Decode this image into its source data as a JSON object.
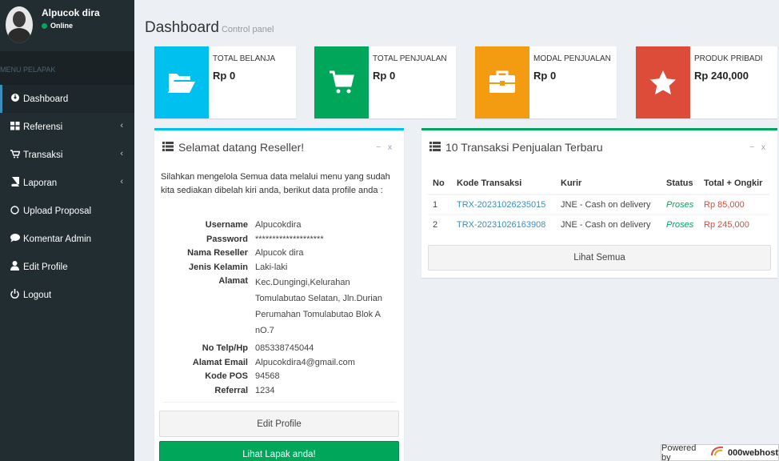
{
  "sidebar": {
    "user_name": "Alpucok dira",
    "user_status": "Online",
    "menu_header": "MENU PELAPAK",
    "items": [
      {
        "label": "Dashboard",
        "icon": "dashboard-icon",
        "has_arrow": false
      },
      {
        "label": "Referensi",
        "icon": "grid-icon",
        "has_arrow": true
      },
      {
        "label": "Transaksi",
        "icon": "cart-icon",
        "has_arrow": true
      },
      {
        "label": "Laporan",
        "icon": "book-icon",
        "has_arrow": true
      },
      {
        "label": "Upload Proposal",
        "icon": "circle-icon",
        "has_arrow": false
      },
      {
        "label": "Komentar Admin",
        "icon": "comment-icon",
        "has_arrow": false
      },
      {
        "label": "Edit Profile",
        "icon": "user-icon",
        "has_arrow": false
      },
      {
        "label": "Logout",
        "icon": "power-icon",
        "has_arrow": false
      }
    ],
    "arrow": "‹"
  },
  "header": {
    "title": "Dashboard",
    "subtitle": "Control panel"
  },
  "info_boxes": [
    {
      "label": "TOTAL BELANJA",
      "value": "Rp 0",
      "icon": "folder-open-icon",
      "color": "#00c0ef"
    },
    {
      "label": "TOTAL PENJUALAN",
      "value": "Rp 0",
      "icon": "shopping-cart-icon",
      "color": "#00a65a"
    },
    {
      "label": "MODAL PENJUALAN",
      "value": "Rp 0",
      "icon": "briefcase-icon",
      "color": "#f39c12"
    },
    {
      "label": "PRODUK PRIBADI",
      "value": "Rp 240,000",
      "icon": "star-icon",
      "color": "#dd4b39"
    }
  ],
  "welcome_panel": {
    "title": "Selamat datang Reseller!",
    "tools": "− x",
    "text": "Silahkan mengelola Semua data melalui menu yang sudah kita sediakan dibelah kiri anda, berikut data profile anda :",
    "profile": [
      {
        "key": "Username",
        "value": "Alpucokdira"
      },
      {
        "key": "Password",
        "value": "********************"
      },
      {
        "key": "Nama Reseller",
        "value": "Alpucok dira"
      },
      {
        "key": "Jenis Kelamin",
        "value": "Laki-laki"
      },
      {
        "key": "Alamat",
        "value": "Kec.Dungingi,Kelurahan Tomulabutao Selatan, Jln.Durian Perumahan Tomulabutao Blok A nO.7"
      },
      {
        "key": "No Telp/Hp",
        "value": "085338745044"
      },
      {
        "key": "Alamat Email",
        "value": "Alpucokdira4@gmail.com"
      },
      {
        "key": "Kode POS",
        "value": "94568"
      },
      {
        "key": "Referral",
        "value": "1234"
      }
    ],
    "edit_button": "Edit Profile",
    "lapak_button": "Lihat Lapak anda!"
  },
  "transactions_panel": {
    "title": "10 Transaksi Penjualan Terbaru",
    "tools": "− x",
    "columns": [
      "No",
      "Kode Transaksi",
      "Kurir",
      "Status",
      "Total + Ongkir"
    ],
    "rows": [
      [
        "1",
        "TRX-20231026235015",
        "JNE - Cash on delivery",
        "Proses",
        "Rp 85,000"
      ],
      [
        "2",
        "TRX-20231026163908",
        "JNE - Cash on delivery",
        "Proses",
        "Rp 245,000"
      ]
    ],
    "view_all": "Lihat Semua"
  },
  "footer": {
    "powered_by": "Powered by",
    "brand": "000webhost"
  }
}
